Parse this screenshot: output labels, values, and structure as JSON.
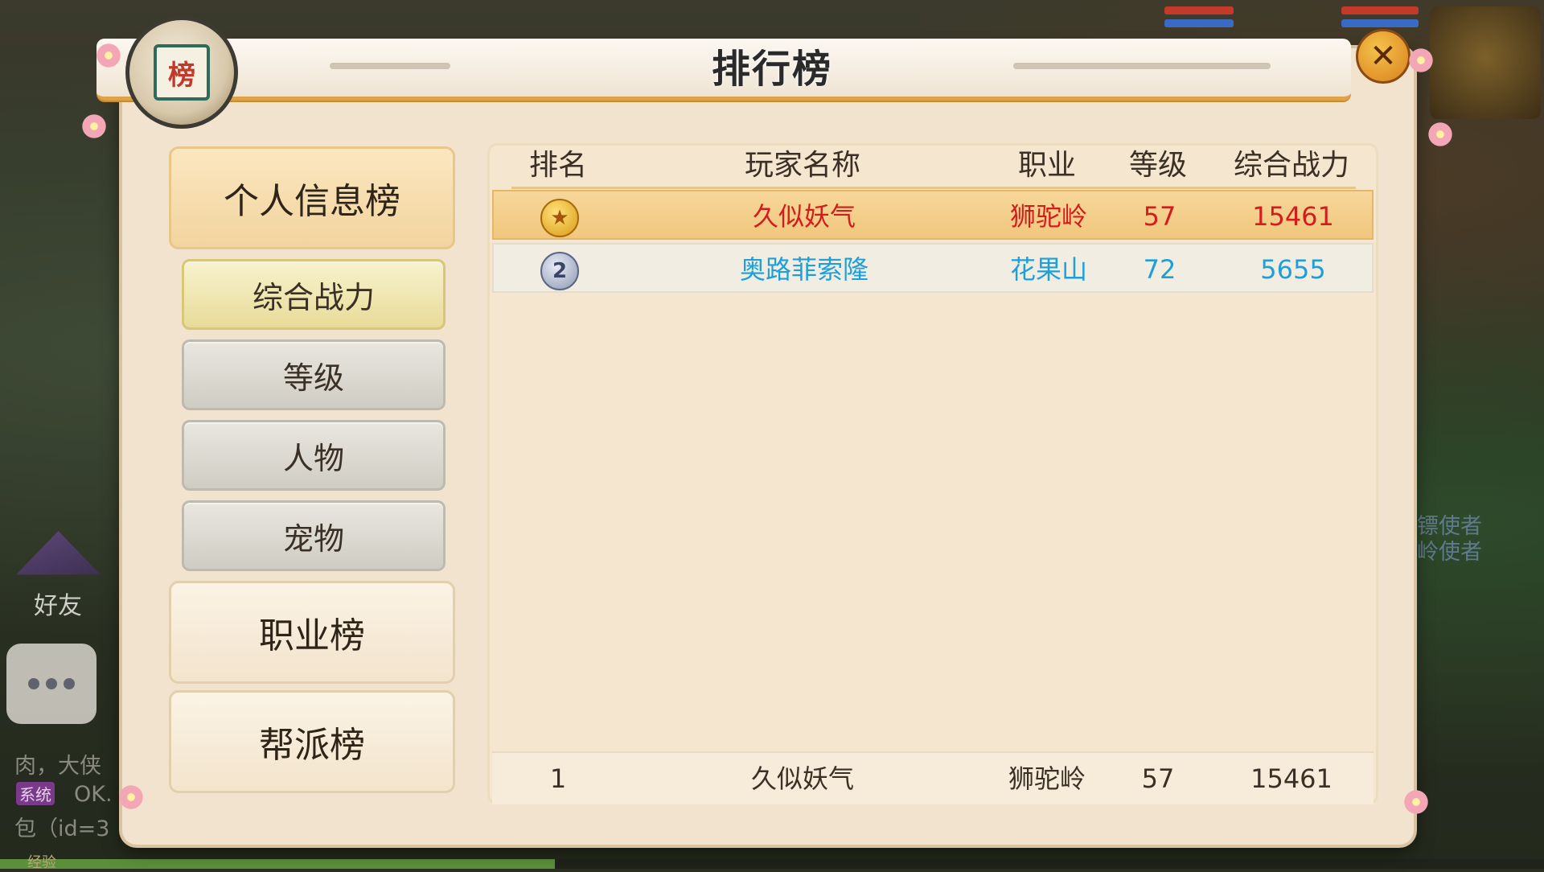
{
  "window": {
    "title": "排行榜",
    "badge_glyph": "榜",
    "close_glyph": "✕"
  },
  "sidebar": {
    "main_personal": "个人信息榜",
    "subs": [
      "综合战力",
      "等级",
      "人物",
      "宠物"
    ],
    "main_profession": "职业榜",
    "main_guild": "帮派榜"
  },
  "table": {
    "headers": [
      "排名",
      "玩家名称",
      "职业",
      "等级",
      "综合战力"
    ],
    "rows": [
      {
        "rank": "1",
        "name": "久似妖气",
        "profession": "狮驼岭",
        "level": "57",
        "power": "15461"
      },
      {
        "rank": "2",
        "name": "奥路菲索隆",
        "profession": "花果山",
        "level": "72",
        "power": "5655"
      }
    ],
    "my_rank": {
      "rank": "1",
      "name": "久似妖气",
      "profession": "狮驼岭",
      "level": "57",
      "power": "15461"
    }
  },
  "background": {
    "friend_label": "好友",
    "chat_lines": [
      "肉，大侠",
      "OK.",
      "包（id=3"
    ],
    "chat_tag": "系统",
    "npc_labels": [
      "镖使者",
      "岭使者"
    ],
    "exp_label": "经验"
  },
  "colors": {
    "first_text": "#d41c1c",
    "second_text": "#1e9fd8",
    "accent": "#e0a247"
  }
}
